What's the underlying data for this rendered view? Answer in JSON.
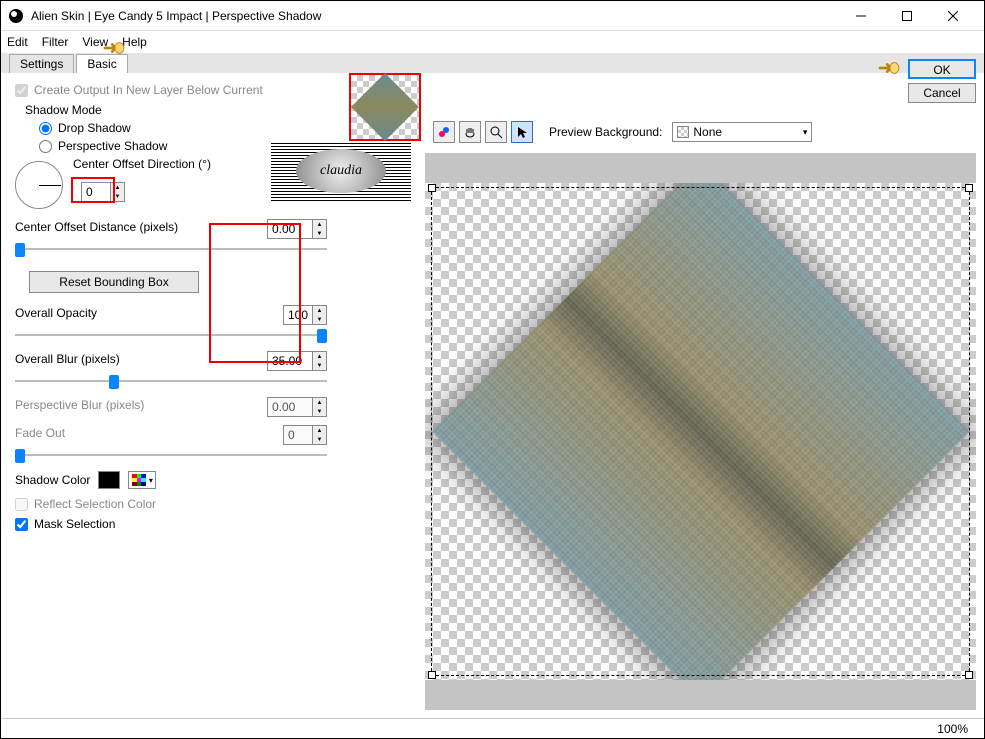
{
  "window": {
    "title": "Alien Skin | Eye Candy 5 Impact | Perspective Shadow"
  },
  "menu": {
    "edit": "Edit",
    "filter": "Filter",
    "view": "View",
    "help": "Help"
  },
  "tabs": {
    "settings": "Settings",
    "basic": "Basic"
  },
  "panel": {
    "createOutput": "Create Output In New Layer Below Current",
    "shadowMode": "Shadow Mode",
    "dropShadow": "Drop Shadow",
    "perspectiveShadow": "Perspective Shadow",
    "centerOffsetDir": "Center Offset Direction (°)",
    "centerOffsetDirValue": "0",
    "centerOffsetDist": "Center Offset Distance (pixels)",
    "centerOffsetDistValue": "0.00",
    "resetBounding": "Reset Bounding Box",
    "overallOpacity": "Overall Opacity",
    "overallOpacityValue": "100",
    "overallBlur": "Overall Blur (pixels)",
    "overallBlurValue": "35.00",
    "perspectiveBlur": "Perspective Blur (pixels)",
    "perspectiveBlurValue": "0.00",
    "fadeOut": "Fade Out",
    "fadeOutValue": "0",
    "shadowColor": "Shadow Color",
    "reflectSelColor": "Reflect Selection Color",
    "maskSelection": "Mask Selection"
  },
  "toolbar": {
    "previewBg": "Preview Background:",
    "previewBgValue": "None"
  },
  "buttons": {
    "ok": "OK",
    "cancel": "Cancel"
  },
  "status": {
    "zoom": "100%"
  },
  "watermark": "claudia"
}
